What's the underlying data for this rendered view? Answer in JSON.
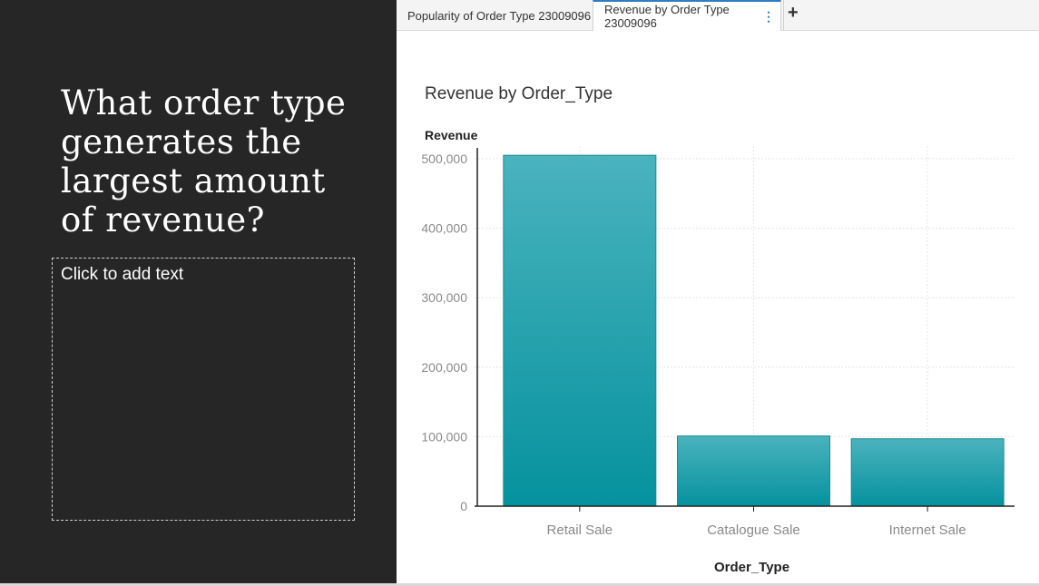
{
  "slide": {
    "title": "What order type generates the largest amount of revenue?",
    "placeholder": "Click to add text"
  },
  "tabs": [
    {
      "label": "Popularity of Order Type 23009096"
    },
    {
      "label": "Revenue by Order Type 23009096"
    }
  ],
  "icons": {
    "tab_menu": "vertical-dots-icon",
    "add_tab": "plus-icon"
  },
  "colors": {
    "bar_top": "#4ab3be",
    "bar_bottom": "#05929e",
    "slide_bg": "#262626"
  },
  "chart_data": {
    "type": "bar",
    "title": "Revenue by Order_Type",
    "xlabel": "Order_Type",
    "ylabel": "Revenue",
    "categories": [
      "Retail Sale",
      "Catalogue Sale",
      "Internet Sale"
    ],
    "values": [
      505000,
      101000,
      97000
    ],
    "ylim": [
      0,
      500000
    ],
    "yticks": [
      0,
      100000,
      200000,
      300000,
      400000,
      500000
    ],
    "ytick_labels": [
      "0",
      "100,000",
      "200,000",
      "300,000",
      "400,000",
      "500,000"
    ],
    "grid": true
  }
}
